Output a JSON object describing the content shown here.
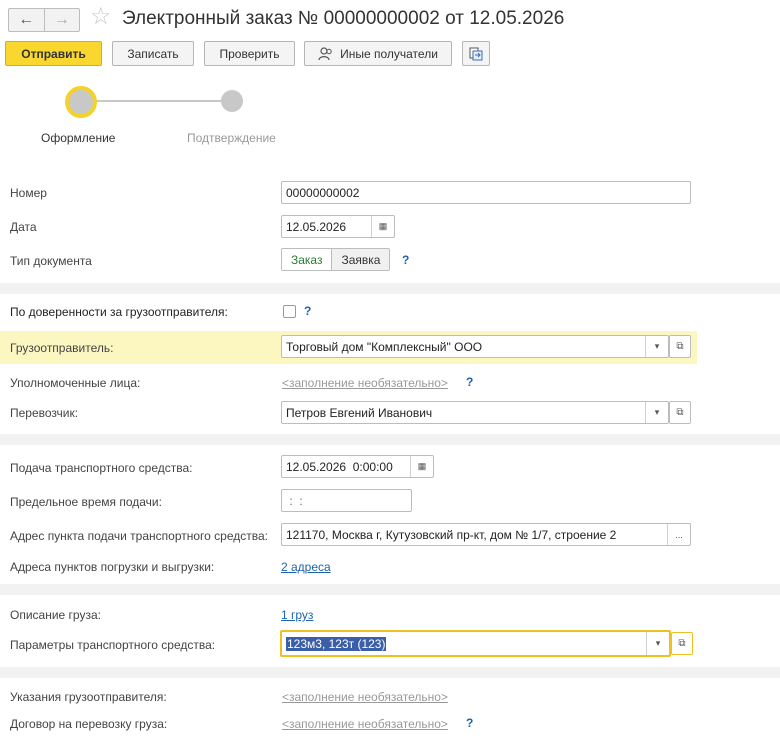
{
  "window": {
    "title": "Электронный заказ № 00000000002 от 12.05.2026",
    "back_icon": "←",
    "forward_icon": "→",
    "star_icon": "☆"
  },
  "toolbar": {
    "send": "Отправить",
    "save": "Записать",
    "check": "Проверить",
    "other_recipients": "Иные получатели"
  },
  "steps": [
    {
      "label": "Оформление",
      "active": true
    },
    {
      "label": "Подтверждение",
      "active": false
    }
  ],
  "form": {
    "number_label": "Номер",
    "number_value": "00000000002",
    "date_label": "Дата",
    "date_value": "12.05.2026",
    "doctype_label": "Тип документа",
    "doctype_options": [
      "Заказ",
      "Заявка"
    ],
    "doctype_selected": "Заказ",
    "proxy_label": "По доверенности за грузоотправителя:",
    "proxy_checked": false,
    "shipper_label": "Грузоотправитель:",
    "shipper_value": "Торговый дом \"Комплексный\" ООО",
    "authorized_label": "Уполномоченные лица:",
    "authorized_hint": "<заполнение необязательно>",
    "carrier_label": "Перевозчик:",
    "carrier_value": "Петров Евгений Иванович",
    "vehicle_time_label": "Подача транспортного средства:",
    "vehicle_time_value": "12.05.2026  0:00:00",
    "deadline_label": "Предельное время подачи:",
    "deadline_value": " :  :",
    "address_label": "Адрес пункта подачи транспортного средства:",
    "address_value": "121170, Москва г, Кутузовский пр-кт, дом № 1/7, строение 2",
    "load_points_label": "Адреса пунктов погрузки и выгрузки:",
    "load_points_link": "2 адреса",
    "cargo_label": "Описание груза:",
    "cargo_link": "1 груз",
    "vehicle_params_label": "Параметры транспортного средства:",
    "vehicle_params_value": "123м3, 123т (123)",
    "instructions_label": "Указания грузоотправителя:",
    "instructions_hint": "<заполнение необязательно>",
    "contract_label": "Договор на перевозку груза:",
    "contract_hint": "<заполнение необязательно>",
    "help_mark": "?",
    "dropdown_icon": "▾",
    "open_icon": "⧉",
    "ellipsis": "...",
    "calendar_icon": "▦"
  },
  "colors": {
    "primary_button": "#f9d72f",
    "highlight_row": "#fcf6c1",
    "link": "#1e63b0",
    "focus_border": "#f0c020"
  }
}
